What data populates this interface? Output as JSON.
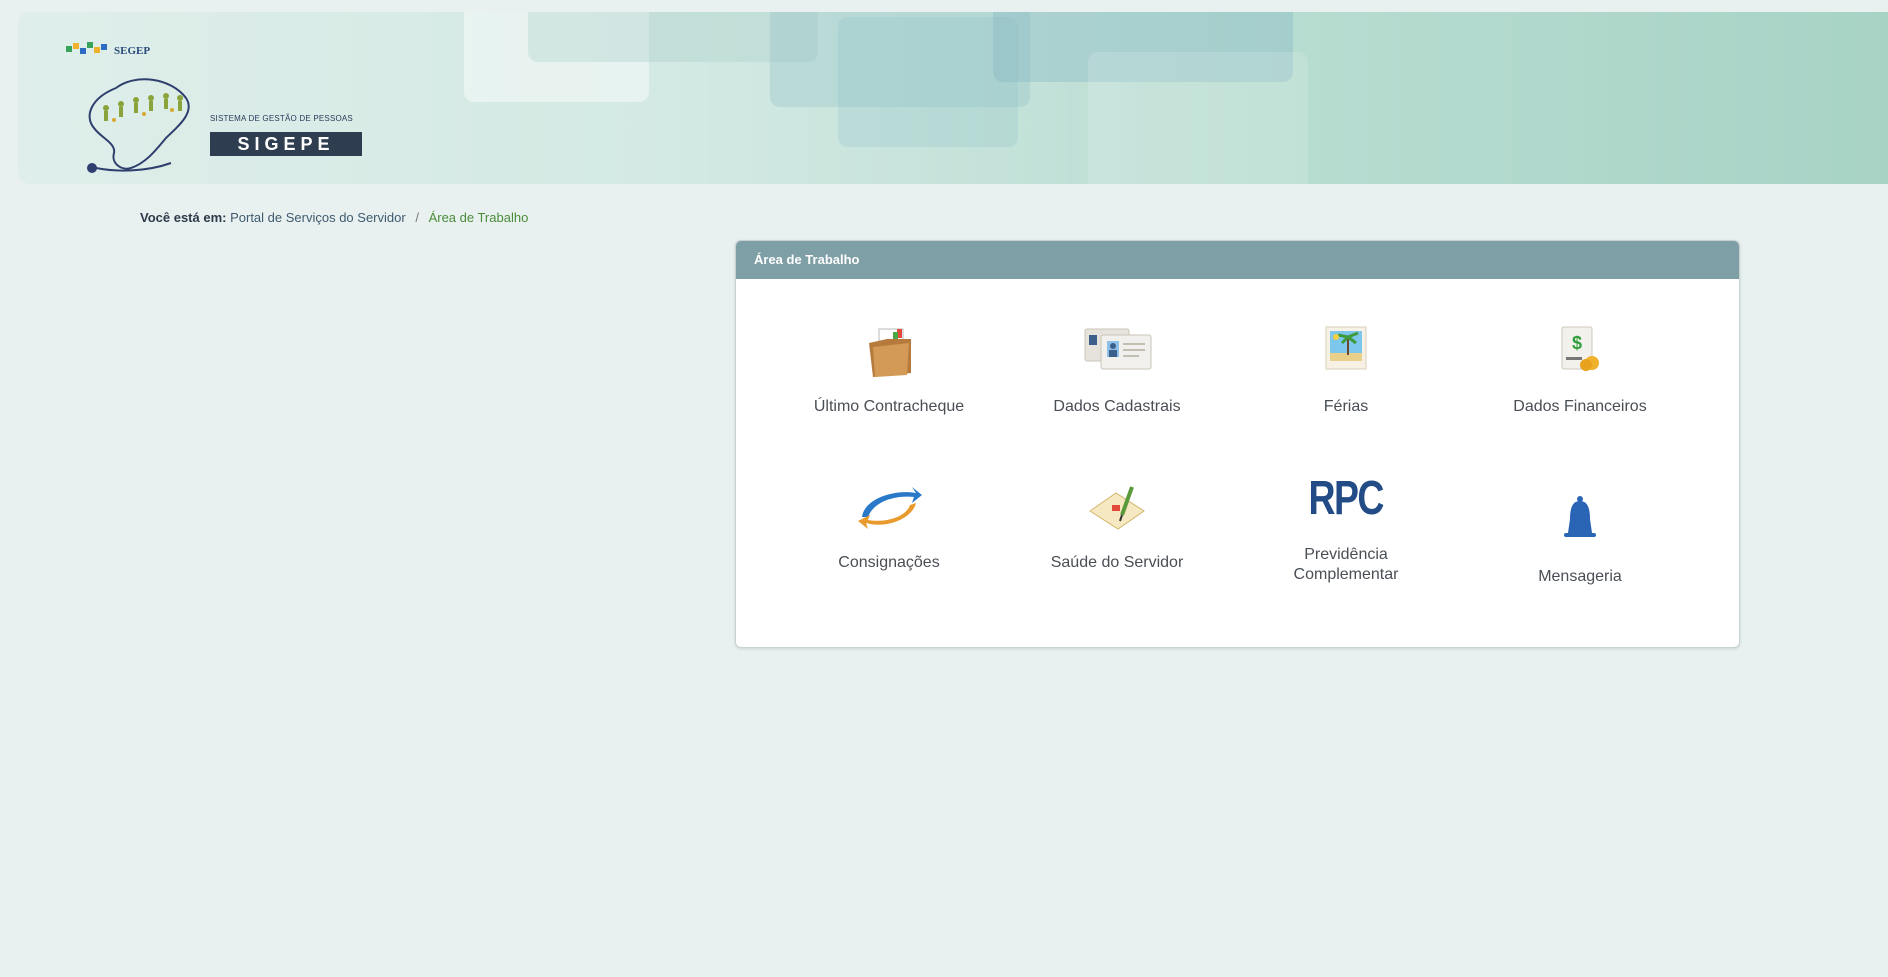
{
  "header": {
    "brand": "SEGEP",
    "system_subtitle": "SISTEMA DE GESTÃO DE PESSOAS",
    "system_name": "SIGEPE"
  },
  "breadcrumb": {
    "lead": "Você está em:",
    "items": [
      "Portal de Serviços do Servidor",
      "Área de Trabalho"
    ],
    "separator": "/"
  },
  "panel": {
    "title": "Área de Trabalho",
    "tiles": [
      {
        "label": "Último Contracheque",
        "icon": "folder-document-icon"
      },
      {
        "label": "Dados Cadastrais",
        "icon": "id-cards-icon"
      },
      {
        "label": "Férias",
        "icon": "beach-photo-icon"
      },
      {
        "label": "Dados Financeiros",
        "icon": "dollar-money-icon"
      },
      {
        "label": "Consignações",
        "icon": "exchange-arrows-icon"
      },
      {
        "label": "Saúde do Servidor",
        "icon": "health-form-icon"
      },
      {
        "label": "Previdência Complementar",
        "icon": "rpc-icon",
        "icon_text": "RPC"
      },
      {
        "label": "Mensageria",
        "icon": "bell-icon"
      }
    ]
  },
  "colors": {
    "background": "#e8f1ef",
    "panel_header": "#7f9fa6",
    "sigepe_box": "#2f3d51",
    "breadcrumb_current": "#4a8b3a",
    "rpc_blue": "#234c86",
    "bell_blue": "#2a64b4"
  }
}
